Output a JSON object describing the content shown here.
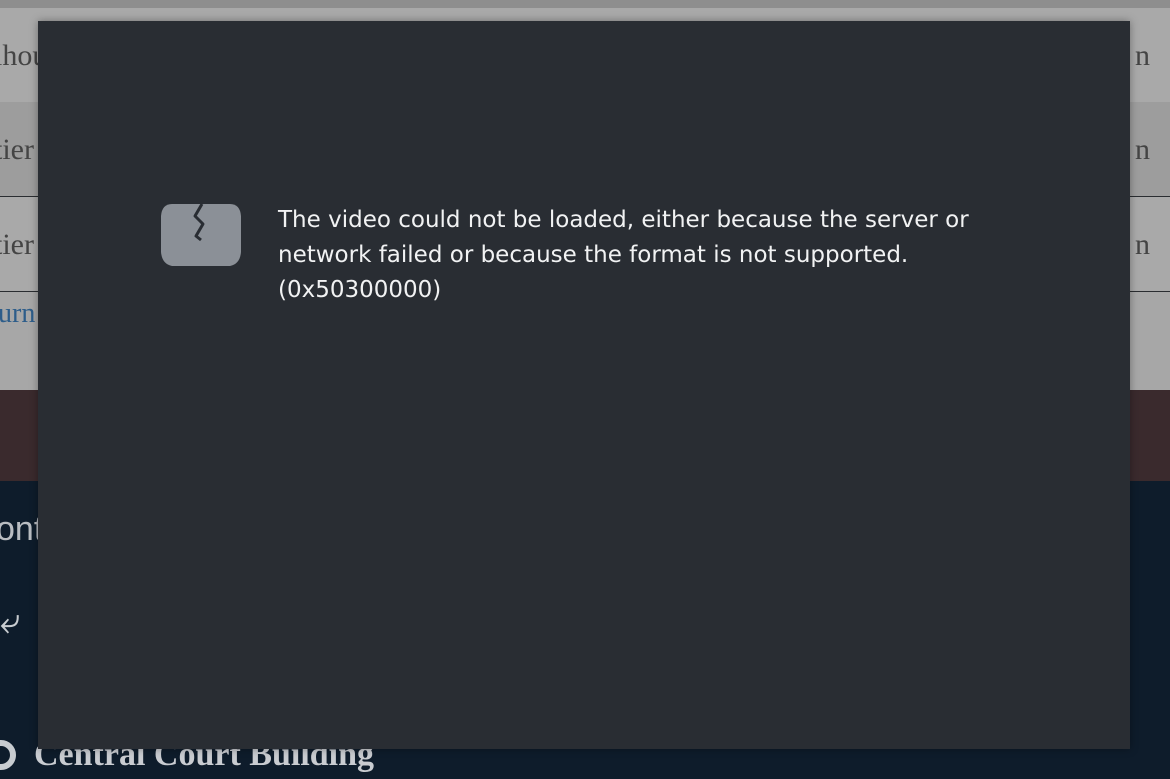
{
  "background": {
    "rows": [
      {
        "left": "lhou",
        "right": "n"
      },
      {
        "left": "tier",
        "right": "n"
      },
      {
        "left": "tier",
        "right": "n"
      }
    ],
    "link_text": "urn",
    "contact_heading": "ont",
    "address": "Central Court Building"
  },
  "player": {
    "icon": "broken-video-icon",
    "error_line1": "The video could not be loaded, either because the server or",
    "error_line2": "network failed or because the format is not supported.",
    "error_code": "(0x50300000)"
  }
}
